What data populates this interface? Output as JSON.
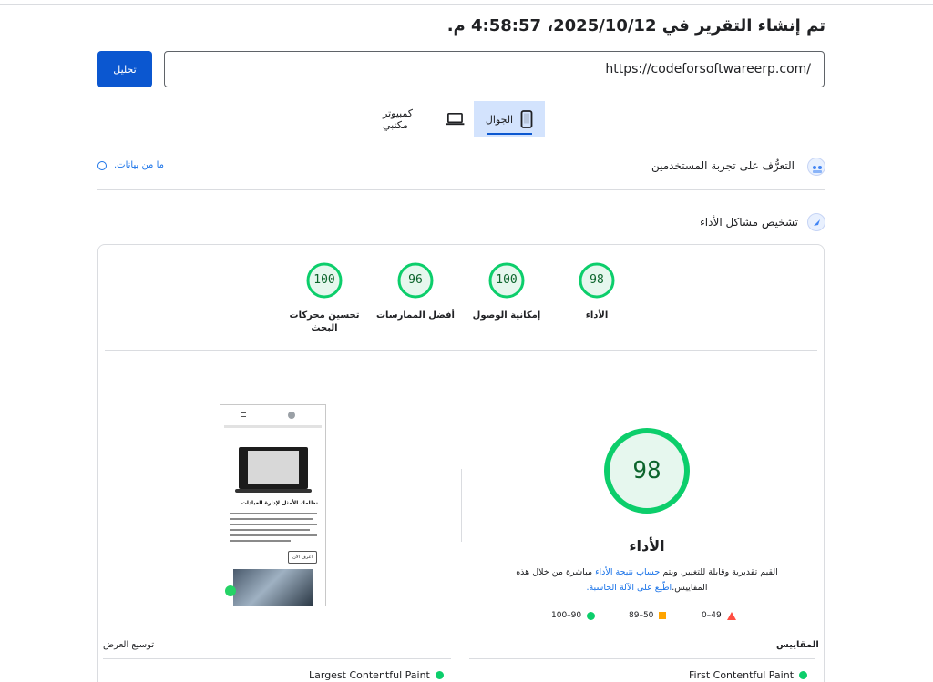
{
  "report": {
    "date_text": "تم إنشاء التقرير في 2025/10/12، 4:58:57 م."
  },
  "search": {
    "url": "https://codeforsoftwareerp.com/",
    "analyze_label": "تحليل"
  },
  "device_tabs": {
    "mobile": "الجوال",
    "desktop": "كمبيوتر مكتبي"
  },
  "experience": {
    "title": "التعرُّف على تجربة المستخدمين",
    "no_data_link": "ما من بيانات."
  },
  "diagnose": {
    "title": "تشخيص مشاكل الأداء"
  },
  "scores": [
    {
      "value": "98",
      "label": "الأداء"
    },
    {
      "value": "100",
      "label": "إمكانية الوصول"
    },
    {
      "value": "96",
      "label": "أفضل الممارسات"
    },
    {
      "value": "100",
      "label": "تحسين محركات البحث"
    }
  ],
  "main_score": {
    "value": "98",
    "title": "الأداء",
    "desc_part1": "القيم تقديرية وقابلة للتغيير. ويتم ",
    "desc_link1": "حساب نتيجة الأداء",
    "desc_part2": " مباشرة من خلال هذه المقاييس.",
    "desc_link2": "اطّلِع على الآلة الحاسبة."
  },
  "legend": {
    "good": "100–90",
    "average": "89–50",
    "poor": "0–49"
  },
  "metrics": {
    "label": "المقاييس",
    "expand": "توسيع العرض",
    "fcp": "First Contentful Paint",
    "lcp": "Largest Contentful Paint"
  },
  "thumbnail": {
    "heading": "نظامك الأمثل لإدارة العيادات",
    "button": "اعرف الآن"
  },
  "colors": {
    "pass": "#0cce6b",
    "pass_text": "#0d652d",
    "average": "#ffa400",
    "fail": "#ff4e42",
    "primary": "#0b57d0"
  }
}
